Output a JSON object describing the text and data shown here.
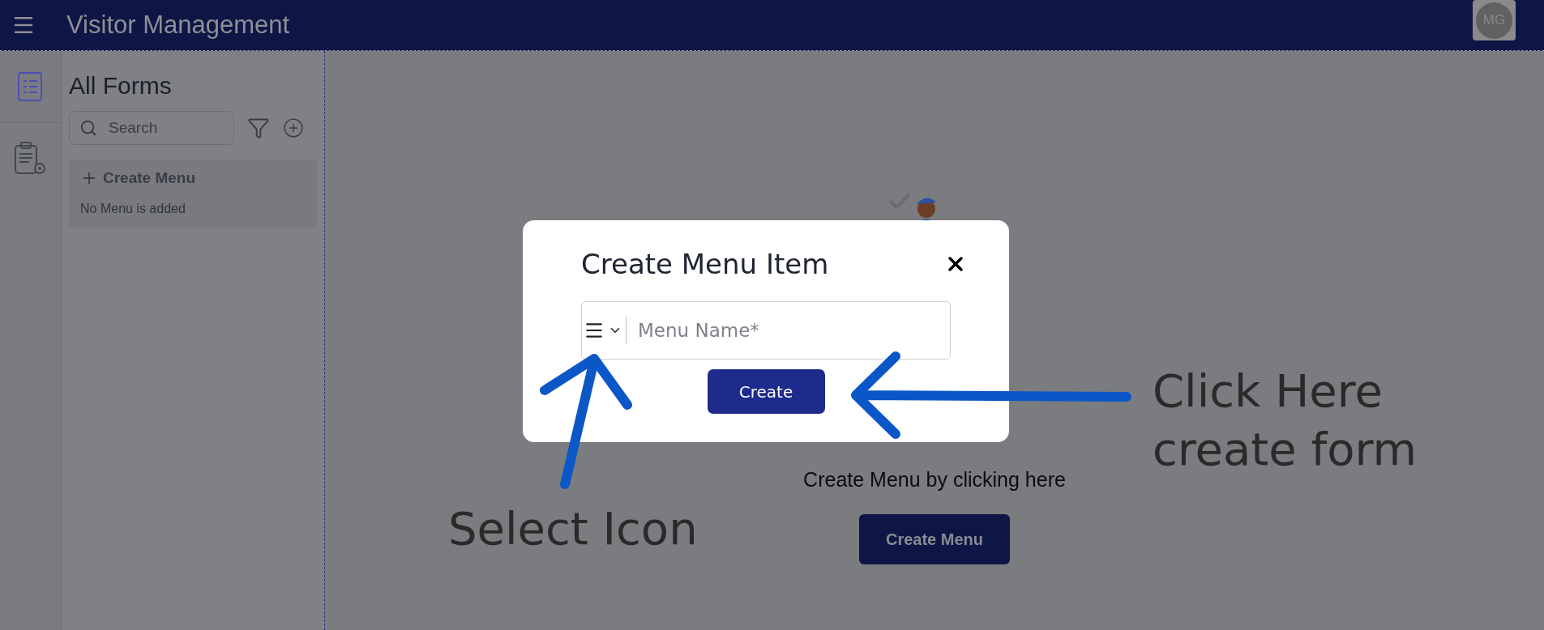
{
  "header": {
    "title": "Visitor Management",
    "avatar_initials": "MG"
  },
  "rail": {
    "items": [
      {
        "kind": "forms",
        "selected": true
      },
      {
        "kind": "form-settings",
        "selected": false
      }
    ]
  },
  "sidebar": {
    "title": "All Forms",
    "search": {
      "placeholder": "Search"
    },
    "menu_card": {
      "create_label": "Create Menu",
      "empty_text": "No Menu is added"
    }
  },
  "main": {
    "hint": "Create Menu by clicking here",
    "button": "Create Menu"
  },
  "modal": {
    "title": "Create Menu Item",
    "field": {
      "placeholder": "Menu Name*"
    },
    "button": "Create"
  },
  "annotations": [
    {
      "lines": [
        "Click Here",
        "create form"
      ]
    },
    {
      "lines": [
        "Select Icon"
      ]
    }
  ]
}
